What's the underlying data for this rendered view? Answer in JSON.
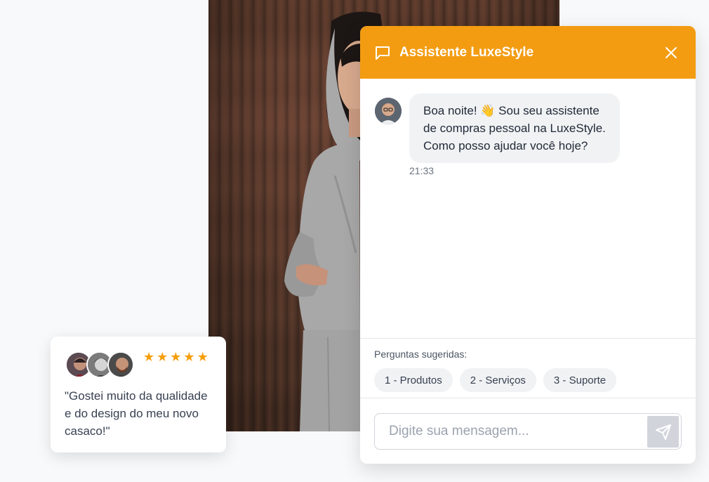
{
  "chat": {
    "title": "Assistente LuxeStyle",
    "message": {
      "text": "Boa noite! 👋 Sou seu assistente de compras pessoal na LuxeStyle. Como posso ajudar você hoje?",
      "time": "21:33"
    },
    "suggestions_label": "Perguntas sugeridas:",
    "suggestions": [
      "1 - Produtos",
      "2 - Serviços",
      "3 - Suporte"
    ],
    "input_placeholder": "Digite sua mensagem...",
    "header_color": "#f39c12"
  },
  "review": {
    "rating": 5,
    "stars": [
      "★",
      "★",
      "★",
      "★",
      "★"
    ],
    "quote": "\"Gostei muito da qualidade e do design do meu novo casaco!\"",
    "star_color": "#f59e0b"
  },
  "icons": {
    "chat_header": "message-square-icon",
    "close": "close-icon",
    "send": "send-icon"
  }
}
